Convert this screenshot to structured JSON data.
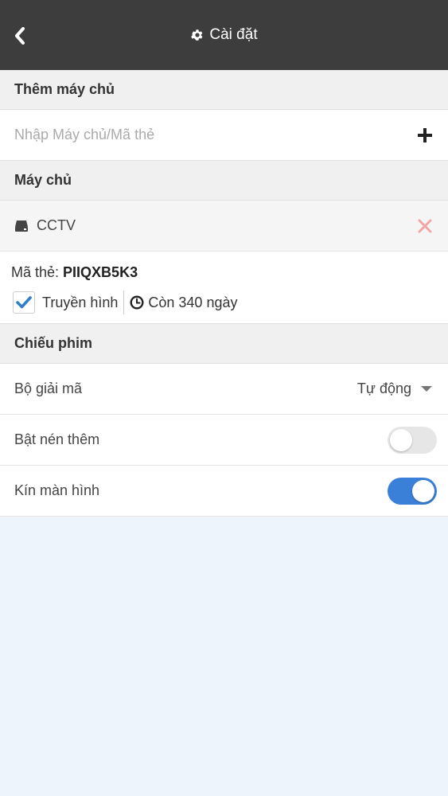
{
  "header": {
    "title": "Cài đặt",
    "back_icon": "chevron-left-icon",
    "title_icon": "gear-icon"
  },
  "add_server": {
    "section_title": "Thêm máy chủ",
    "input_placeholder": "Nhập Máy chủ/Mã thẻ",
    "input_value": "",
    "add_icon": "plus-icon"
  },
  "servers": {
    "section_title": "Máy chủ",
    "items": [
      {
        "icon": "hard-drive-icon",
        "name": "CCTV",
        "remove_icon": "close-icon"
      }
    ]
  },
  "card": {
    "code_label": "Mã thẻ:",
    "code_value": "PIIQXB5K3",
    "tv_label": "Truyền hình",
    "tv_checked": true,
    "expiry_icon": "clock-icon",
    "expiry_text": "Còn 340 ngày"
  },
  "playback": {
    "section_title": "Chiếu phim",
    "decoder_label": "Bộ giải mã",
    "decoder_value": "Tự động",
    "compression_label": "Bật nén thêm",
    "compression_on": false,
    "fullscreen_label": "Kín màn hình",
    "fullscreen_on": true
  },
  "colors": {
    "header_bg": "#3d3d3d",
    "accent": "#3a7fd8",
    "remove": "#f2a5a5",
    "check": "#2f7fc9"
  }
}
